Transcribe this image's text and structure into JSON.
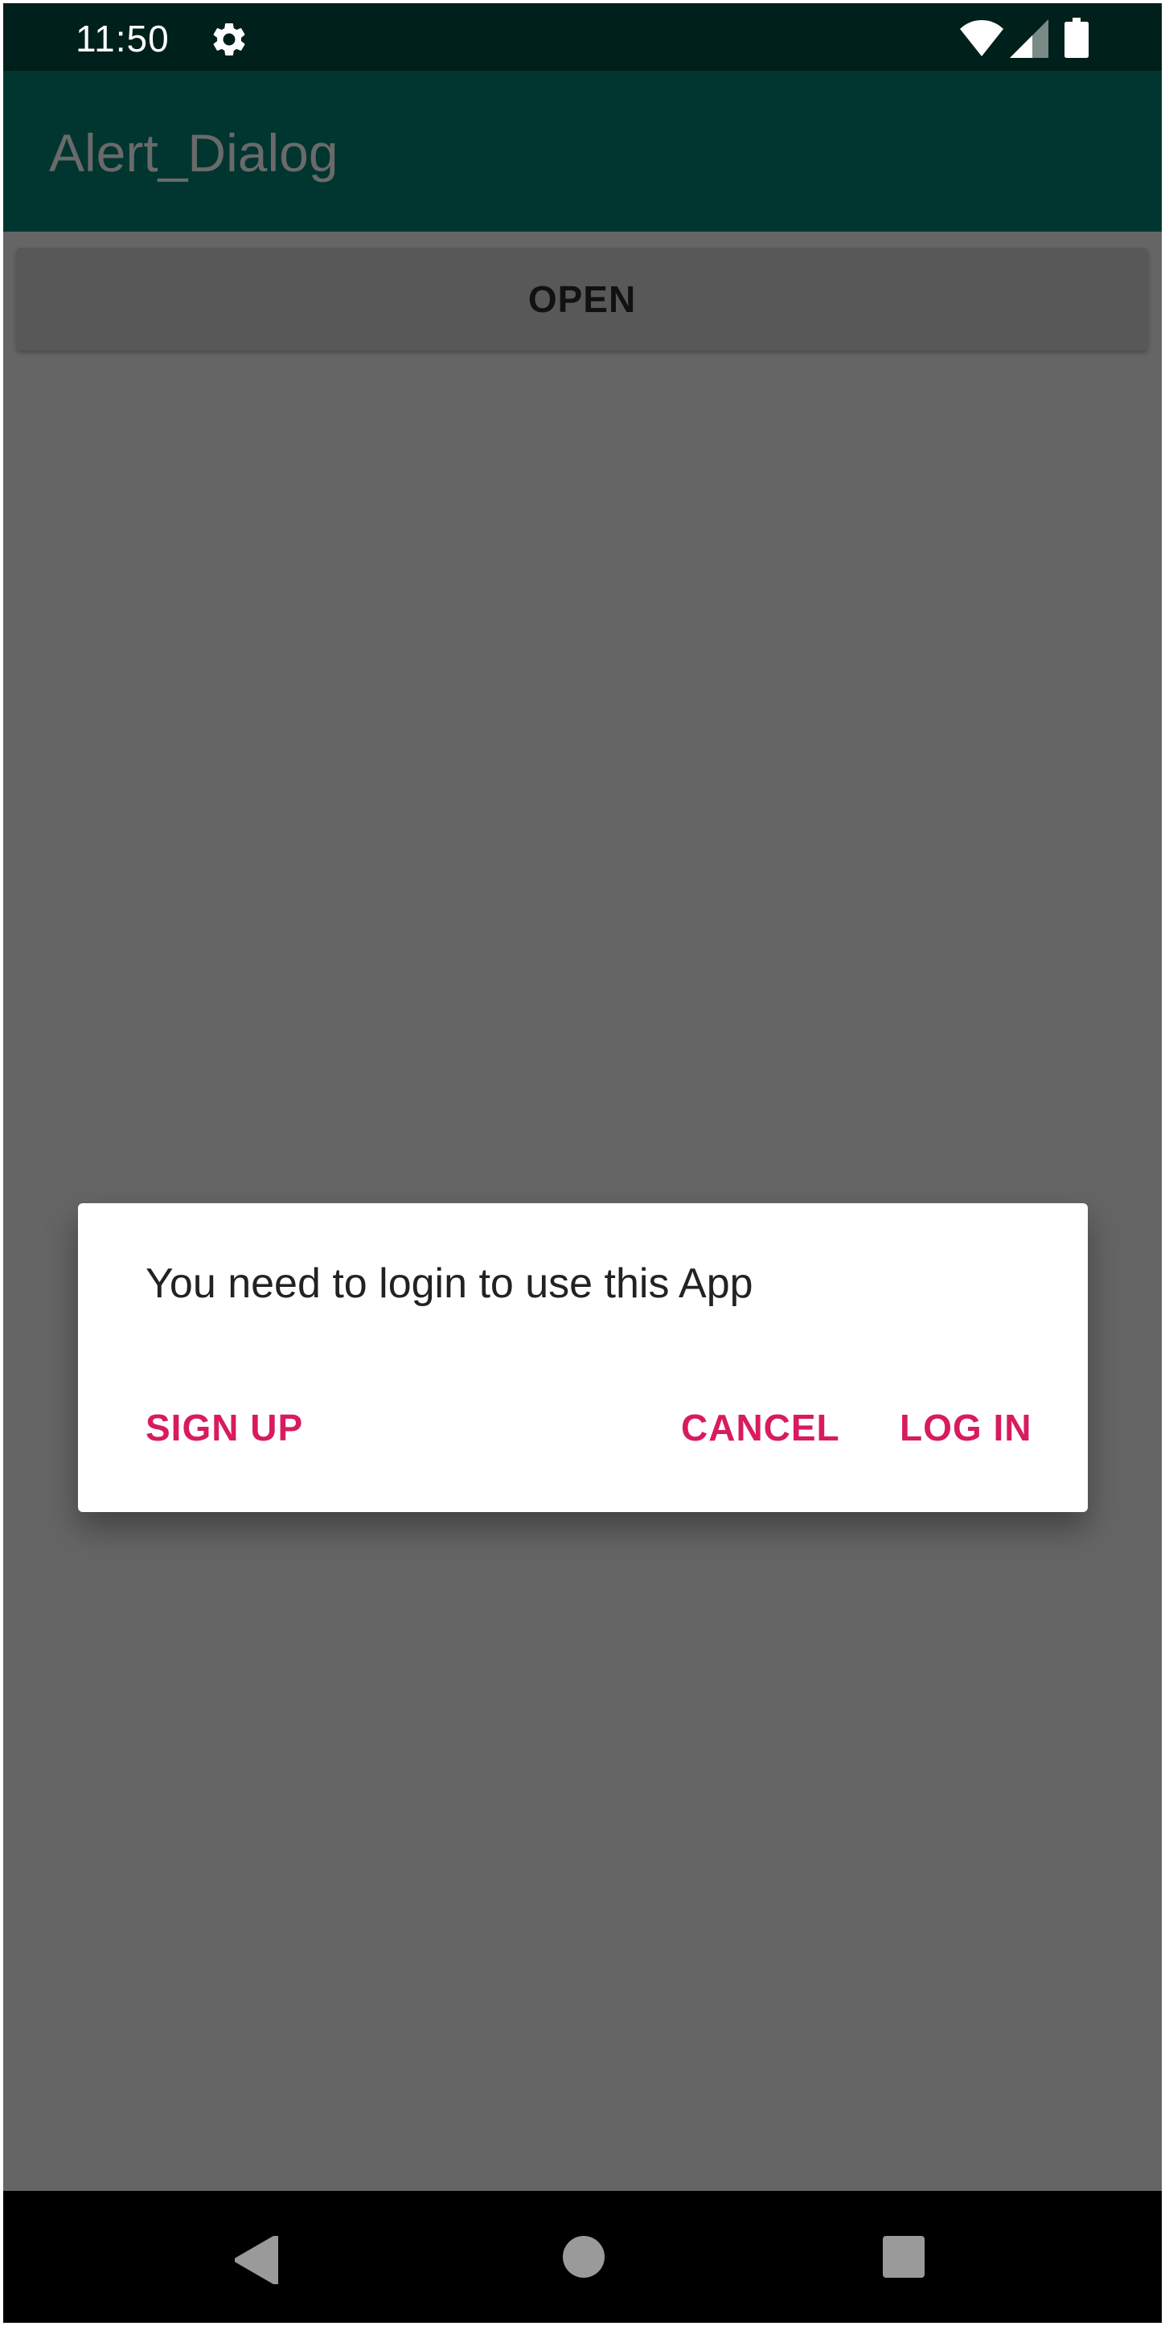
{
  "status_bar": {
    "time": "11:50",
    "icons": [
      "gear-icon",
      "wifi-icon",
      "signal-icon",
      "battery-icon"
    ]
  },
  "app_bar": {
    "title": "Alert_Dialog"
  },
  "main": {
    "open_button_label": "OPEN"
  },
  "dialog": {
    "message": "You need to login to use this App",
    "buttons": {
      "sign_up": "SIGN UP",
      "cancel": "CANCEL",
      "log_in": "LOG IN"
    }
  },
  "nav_bar": {
    "icons": [
      "back-icon",
      "home-icon",
      "recents-icon"
    ]
  },
  "colors": {
    "status_bar_bg": "#00201b",
    "app_bar_bg": "#013630",
    "scrim_bg": "#656565",
    "accent": "#d81b60"
  }
}
